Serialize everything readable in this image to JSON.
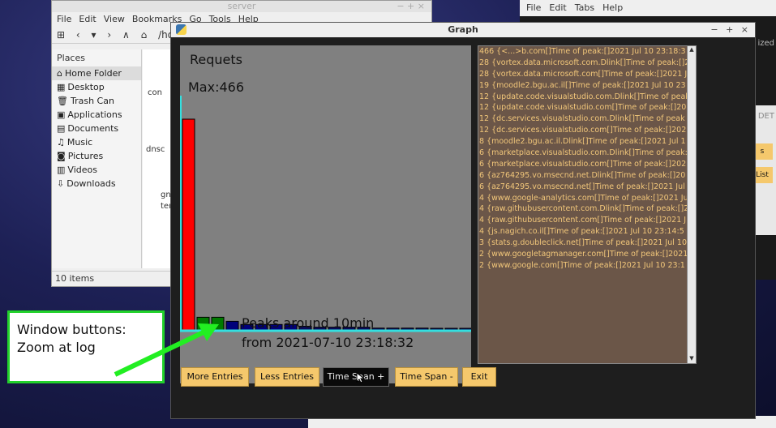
{
  "file_manager": {
    "title": "server",
    "window_buttons": "− + ×",
    "menu": [
      "File",
      "Edit",
      "View",
      "Bookmarks",
      "Go",
      "Tools",
      "Help"
    ],
    "path": "/ho",
    "places_header": "Places",
    "places": [
      {
        "icon": "home-icon",
        "glyph": "⌂",
        "label": "Home Folder"
      },
      {
        "icon": "desktop-icon",
        "glyph": "▦",
        "label": "Desktop"
      },
      {
        "icon": "trash-icon",
        "glyph": "🗑",
        "label": "Trash Can"
      },
      {
        "icon": "applications-icon",
        "glyph": "▣",
        "label": "Applications"
      },
      {
        "icon": "documents-icon",
        "glyph": "▤",
        "label": "Documents"
      },
      {
        "icon": "music-icon",
        "glyph": "♫",
        "label": "Music"
      },
      {
        "icon": "pictures-icon",
        "glyph": "◙",
        "label": "Pictures"
      },
      {
        "icon": "videos-icon",
        "glyph": "▥",
        "label": "Videos"
      },
      {
        "icon": "downloads-icon",
        "glyph": "⇩",
        "label": "Downloads"
      }
    ],
    "files": [
      "con",
      "dnsc",
      "gn",
      "ter"
    ],
    "status": "10 items"
  },
  "terminal": {
    "menu": [
      "File",
      "Edit",
      "Tabs",
      "Help"
    ],
    "side_labels": [
      "ized",
      "DET",
      "s",
      "List"
    ]
  },
  "graph_window": {
    "title": "Graph",
    "window_buttons": [
      "−",
      "+",
      "×"
    ],
    "plot_title": "Requets",
    "max_label": "Max:466",
    "peak_line1": "Peaks around 10min",
    "peak_line2": "from 2021-07-10 23:18:32",
    "entries": [
      "466 {<...>b.com[]Time of peak:[]2021 Jul 10 23:18:3",
      "28 {vortex.data.microsoft.com.Dlink[]Time of peak:[]2",
      "28 {vortex.data.microsoft.com[]Time of peak:[]2021 J",
      "19 {moodle2.bgu.ac.il[]Time of peak:[]2021 Jul 10 23",
      "12 {update.code.visualstudio.com.Dlink[]Time of peak",
      "12 {update.code.visualstudio.com[]Time of peak:[]20",
      "12 {dc.services.visualstudio.com.Dlink[]Time of peak",
      "12 {dc.services.visualstudio.com[]Time of peak:[]202",
      "8 {moodle2.bgu.ac.il.Dlink[]Time of peak:[]2021 Jul 1",
      "6 {marketplace.visualstudio.com.Dlink[]Time of peak:",
      "6 {marketplace.visualstudio.com[]Time of peak:[]202",
      "6 {az764295.vo.msecnd.net.Dlink[]Time of peak:[]20",
      "6 {az764295.vo.msecnd.net[]Time of peak:[]2021 Jul",
      "4 {www.google-analytics.com[]Time of peak:[]2021 Ju",
      "4 {raw.githubusercontent.com.Dlink[]Time of peak:[]2",
      "4 {raw.githubusercontent.com[]Time of peak:[]2021 J",
      "4 {js.nagich.co.il[]Time of peak:[]2021 Jul 10 23:14:5",
      "3 {stats.g.doubleclick.net[]Time of peak:[]2021 Jul 10",
      "2 {www.googletagmanager.com[]Time of peak:[]2021",
      "2 {www.google.com[]Time of peak:[]2021 Jul 10 23:1"
    ],
    "buttons": [
      {
        "name": "more-entries-button",
        "label": "More Entries",
        "dark": false
      },
      {
        "name": "less-entries-button",
        "label": "Less Entries",
        "dark": false
      },
      {
        "name": "time-span-plus-button",
        "label": "Time Span +",
        "dark": true
      },
      {
        "name": "time-span-minus-button",
        "label": "Time Span -",
        "dark": false
      },
      {
        "name": "exit-button",
        "label": "Exit",
        "dark": false
      }
    ],
    "chart": {
      "values": [
        466,
        28,
        28,
        19,
        12,
        12,
        12,
        12,
        8,
        6,
        6,
        6,
        6,
        4,
        4,
        4,
        4,
        3,
        2,
        2
      ],
      "colors": [
        "#ff0000",
        "#007a00",
        "#007a00",
        "#00007a",
        "#00007a",
        "#00007a",
        "#00007a",
        "#00007a",
        "#0a0a5a",
        "#0a0a5a",
        "#0a0a5a",
        "#0a0a5a",
        "#0a0a5a",
        "#0a0a5a",
        "#0a0a5a",
        "#0a0a5a",
        "#0a0a5a",
        "#0a0a5a",
        "#0a0a5a",
        "#0a0a5a"
      ],
      "axis_color": "#33e0e0"
    }
  },
  "annotation": {
    "line1": "Window buttons:",
    "line2": "Zoom at log",
    "color": "#22d22b"
  }
}
